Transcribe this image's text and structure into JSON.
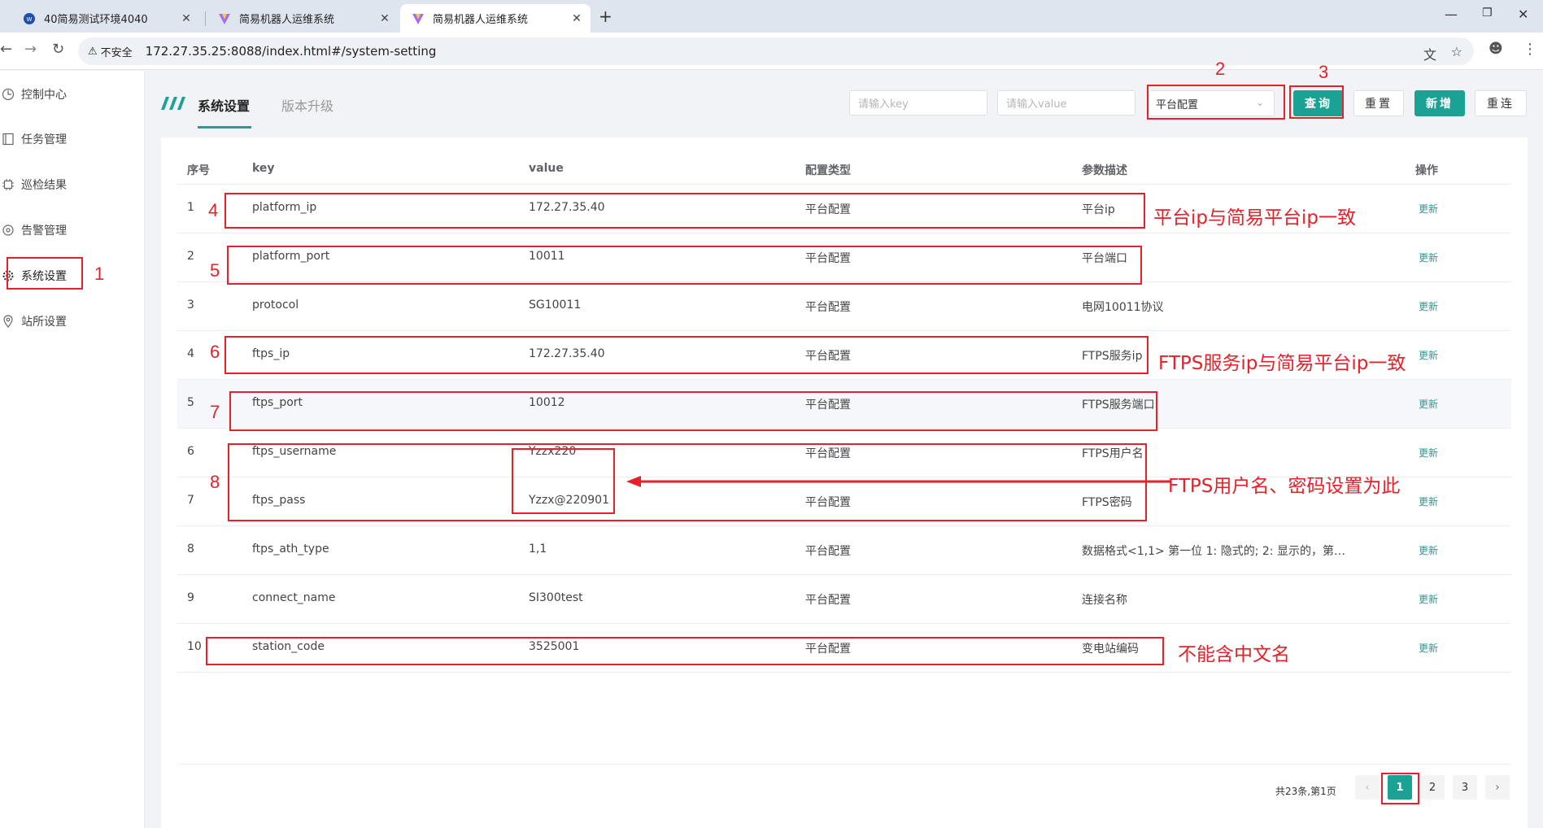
{
  "browser": {
    "tabs": [
      {
        "title": "40简易测试环境4040",
        "close": "✕",
        "active": false
      },
      {
        "title": "简易机器人运维系统",
        "close": "✕",
        "active": false
      },
      {
        "title": "简易机器人运维系统",
        "close": "✕",
        "active": true
      }
    ],
    "new_tab": "+",
    "security_label": "不安全",
    "url": "172.27.35.25:8088/index.html#/system-setting"
  },
  "sidebar": {
    "items": [
      {
        "label": "控制中心",
        "icon": "dashboard-icon"
      },
      {
        "label": "任务管理",
        "icon": "task-icon"
      },
      {
        "label": "巡检结果",
        "icon": "chip-icon"
      },
      {
        "label": "告警管理",
        "icon": "alert-icon"
      },
      {
        "label": "系统设置",
        "icon": "gear-icon"
      },
      {
        "label": "站所设置",
        "icon": "location-icon"
      }
    ]
  },
  "main": {
    "tabs": [
      {
        "label": "系统设置",
        "active": true
      },
      {
        "label": "版本升级",
        "active": false
      }
    ],
    "filters": {
      "key_placeholder": "请输入key",
      "value_placeholder": "请输入value",
      "config_type_selected": "平台配置"
    },
    "buttons": {
      "query": "查询",
      "reset": "重置",
      "add": "新增",
      "reconnect": "重连"
    },
    "table": {
      "columns": [
        "序号",
        "key",
        "value",
        "配置类型",
        "参数描述",
        "操作"
      ],
      "rows": [
        {
          "index": "1",
          "key": "platform_ip",
          "value": "172.27.35.40",
          "type": "平台配置",
          "desc": "平台ip",
          "action": "更新"
        },
        {
          "index": "2",
          "key": "platform_port",
          "value": "10011",
          "type": "平台配置",
          "desc": "平台端口",
          "action": "更新"
        },
        {
          "index": "3",
          "key": "protocol",
          "value": "SG10011",
          "type": "平台配置",
          "desc": "电网10011协议",
          "action": "更新"
        },
        {
          "index": "4",
          "key": "ftps_ip",
          "value": "172.27.35.40",
          "type": "平台配置",
          "desc": "FTPS服务ip",
          "action": "更新"
        },
        {
          "index": "5",
          "key": "ftps_port",
          "value": "10012",
          "type": "平台配置",
          "desc": "FTPS服务端口",
          "action": "更新"
        },
        {
          "index": "6",
          "key": "ftps_username",
          "value": "Yzzx220",
          "type": "平台配置",
          "desc": "FTPS用户名",
          "action": "更新"
        },
        {
          "index": "7",
          "key": "ftps_pass",
          "value": "Yzzx@220901",
          "type": "平台配置",
          "desc": "FTPS密码",
          "action": "更新"
        },
        {
          "index": "8",
          "key": "ftps_ath_type",
          "value": "1,1",
          "type": "平台配置",
          "desc": "数据格式<1,1> 第一位 1: 隐式的; 2: 显示的，第…",
          "action": "更新"
        },
        {
          "index": "9",
          "key": "connect_name",
          "value": "SI300test",
          "type": "平台配置",
          "desc": "连接名称",
          "action": "更新"
        },
        {
          "index": "10",
          "key": "station_code",
          "value": "3525001",
          "type": "平台配置",
          "desc": "变电站编码",
          "action": "更新"
        }
      ]
    },
    "pagination": {
      "total": "共23条,第1页",
      "prev": "‹",
      "next": "›",
      "pages": [
        "1",
        "2",
        "3"
      ],
      "current": "1"
    }
  },
  "annotations": {
    "numbers": [
      "1",
      "2",
      "3",
      "4",
      "5",
      "6",
      "7",
      "8"
    ],
    "notes": {
      "platform_ip": "平台ip与简易平台ip一致",
      "ftps_ip": "FTPS服务ip与简易平台ip一致",
      "ftps_credentials": "FTPS用户名、密码设置为此",
      "station_code": "不能含中文名"
    },
    "color": "#e8202a"
  },
  "colors": {
    "accent": "#1aa395",
    "annotation": "#e8202a"
  }
}
